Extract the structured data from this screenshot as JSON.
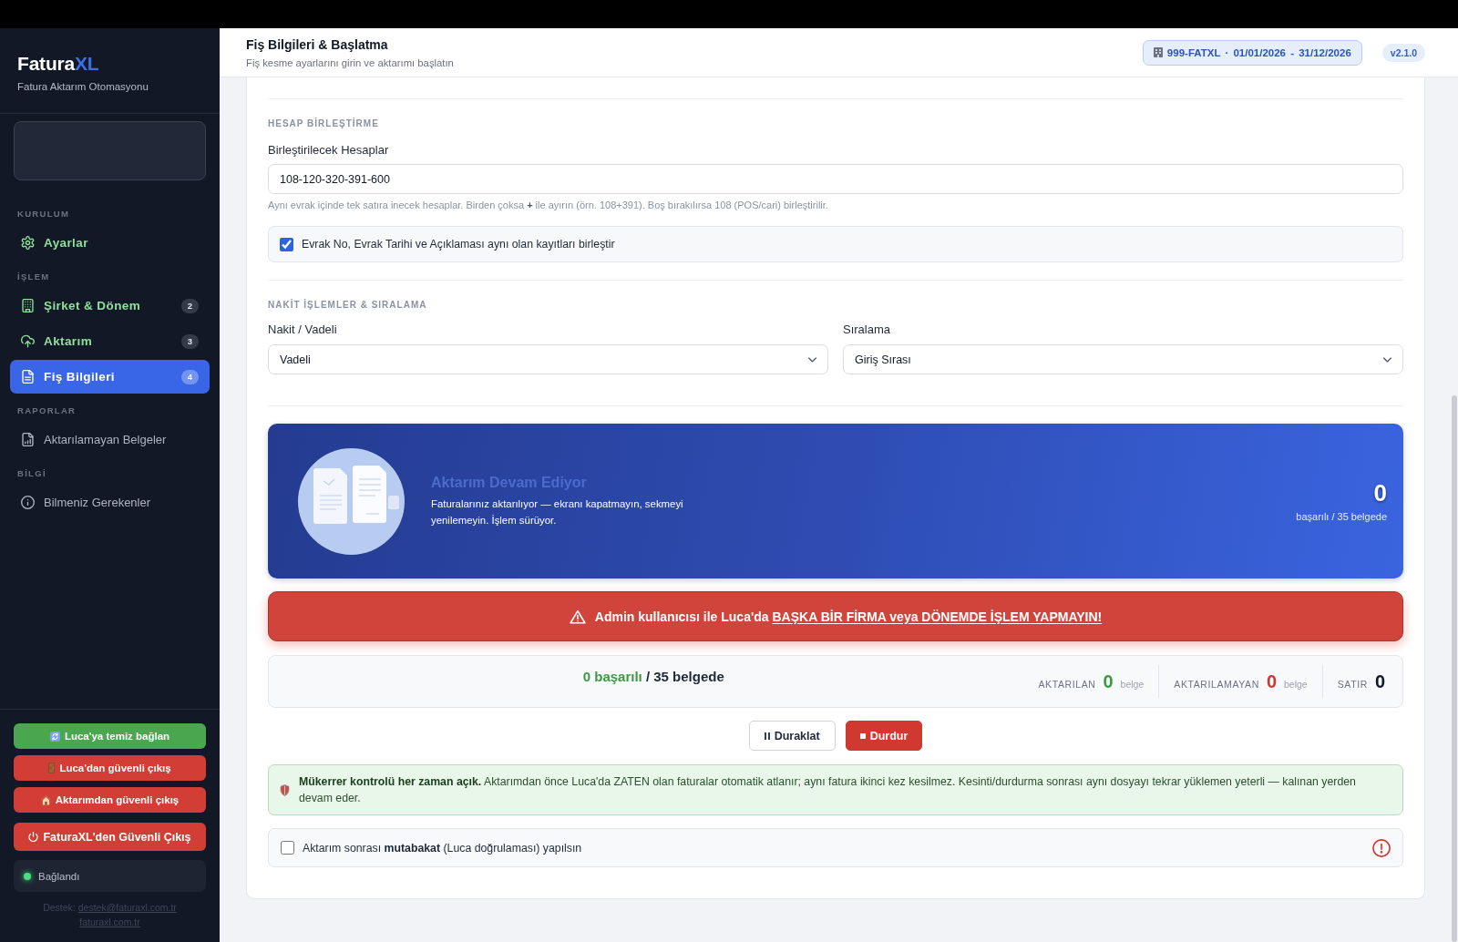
{
  "sidebar": {
    "logo": {
      "main": "Fatura",
      "accent": "XL"
    },
    "tagline": "Fatura Aktarım Otomasyonu",
    "sections": [
      {
        "title": "KURULUM",
        "items": [
          {
            "label": "Ayarlar",
            "selected": false,
            "completed": true
          }
        ]
      },
      {
        "title": "İŞLEM",
        "items": [
          {
            "label": "Şirket & Dönem",
            "badge": "2",
            "selected": false,
            "completed": true
          },
          {
            "label": "Aktarım",
            "badge": "3",
            "selected": false,
            "completed": true
          },
          {
            "label": "Fiş Bilgileri",
            "badge": "4",
            "selected": true,
            "completed": false
          }
        ]
      },
      {
        "title": "RAPORLAR",
        "items": [
          {
            "label": "Aktarılamayan Belgeler",
            "selected": false,
            "completed": false
          }
        ]
      },
      {
        "title": "BİLGİ",
        "items": [
          {
            "label": "Bilmeniz Gerekenler",
            "selected": false,
            "completed": false
          }
        ]
      }
    ],
    "actions": [
      {
        "label": "Luca'ya temiz bağlan",
        "kind": "safe"
      },
      {
        "label": "Luca'dan güvenli çıkış",
        "kind": "danger"
      },
      {
        "label": "Aktarımdan güvenli çıkış",
        "kind": "danger"
      },
      {
        "label": "FaturaXL'den Güvenli Çıkış",
        "kind": "primary"
      }
    ],
    "status": {
      "label": "Bağlandı",
      "connected": true
    },
    "support": {
      "prefix": "Destek:",
      "email": "destek@faturaxl.com.tr",
      "site": "faturaxl.com.tr"
    }
  },
  "header": {
    "title": "Fiş Bilgileri & Başlatma",
    "subtitle": "Fiş kesme ayarlarını girin ve aktarımı başlatın",
    "context": "999-FATXL · 01/01/2026 - 31/12/2026",
    "version": "v2.1.0"
  },
  "form": {
    "merge": {
      "title": "HESAP BİRLEŞTİRME",
      "field": {
        "label": "Birleştirilecek Hesaplar",
        "value": "108-120-320-391-600"
      },
      "help": "Aynı evrak içinde tek satıra inecek hesaplar. Birden çoksa **+** ile ayırın (örn. 108+391). Boş bırakılırsa 108 (POS/cari) birleştirilir.",
      "option": {
        "label": "Evrak No, Evrak Tarihi ve Açıklaması aynı olan kayıtları birleştir",
        "checked": true
      }
    },
    "cash": {
      "title": "NAKİT İŞLEMLER & SIRALAMA",
      "selects": [
        {
          "label": "Nakit / Vadeli",
          "value": "Vadeli"
        },
        {
          "label": "Sıralama",
          "value": "Giriş Sırası"
        }
      ]
    }
  },
  "progress_banner": {
    "title": "Aktarım Devam Ediyor",
    "message": "Faturalarınız aktarılıyor — ekranı kapatmayın, sekmeyi yenilemeyin. İşlem sürüyor.",
    "count": "0",
    "count_caption": "başarılı / 35 belgede"
  },
  "warning": {
    "lead": "Admin kullanıcısı ile Luca'da",
    "emphasis": "BAŞKA BİR FİRMA veya DÖNEMDE İŞLEM YAPMAYIN!"
  },
  "summary": {
    "success": "0 başarılı",
    "total": "/ 35 belgede",
    "stats": [
      {
        "label": "AKTARILAN",
        "value": "0",
        "unit": "belge",
        "kind": "success"
      },
      {
        "label": "AKTARILAMAYAN",
        "value": "0",
        "unit": "belge",
        "kind": "failure"
      },
      {
        "label": "SATIR",
        "value": "0",
        "kind": "neutral"
      }
    ]
  },
  "controls": [
    {
      "label": "Duraklat",
      "kind": "pause"
    },
    {
      "label": "Durdur",
      "kind": "stop"
    }
  ],
  "notice": {
    "text": "**Mükerrer kontrolü her zaman açık.** Aktarımdan önce Luca'da ZATEN olan faturalar otomatik atlanır; aynı fatura ikinci kez kesilmez. Kesinti/durdurma sonrası aynı dosyayı tekrar yüklemen yeterli — kalınan yerden devam eder."
  },
  "reconcile": {
    "label": "Aktarım sonrası **mutabakat** (Luca doğrulaması) yapılsın",
    "checked": false
  }
}
